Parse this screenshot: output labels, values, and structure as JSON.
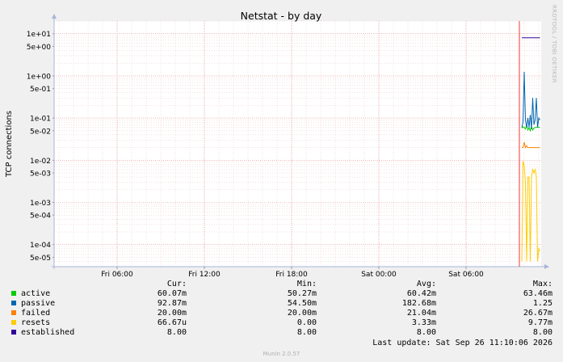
{
  "chart_data": {
    "type": "line",
    "title": "Netstat - by day",
    "ylabel": "TCP connections",
    "yscale": "log",
    "ylim": [
      3e-05,
      20
    ],
    "yticks": [
      {
        "value": 10,
        "label": "1e+01"
      },
      {
        "value": 5,
        "label": "5e+00"
      },
      {
        "value": 1,
        "label": "1e+00"
      },
      {
        "value": 0.5,
        "label": "5e-01"
      },
      {
        "value": 0.1,
        "label": "1e-01"
      },
      {
        "value": 0.05,
        "label": "5e-02"
      },
      {
        "value": 0.01,
        "label": "1e-02"
      },
      {
        "value": 0.005,
        "label": "5e-03"
      },
      {
        "value": 0.001,
        "label": "1e-03"
      },
      {
        "value": 0.0005,
        "label": "5e-04"
      },
      {
        "value": 0.0001,
        "label": "1e-04"
      },
      {
        "value": 5e-05,
        "label": "5e-05"
      }
    ],
    "xlim": [
      "Fri 01:40",
      "Sat 11:10"
    ],
    "xticks": [
      {
        "value": "Fri 06:00",
        "label": "Fri 06:00"
      },
      {
        "value": "Fri 12:00",
        "label": "Fri 12:00"
      },
      {
        "value": "Fri 18:00",
        "label": "Fri 18:00"
      },
      {
        "value": "Sat 00:00",
        "label": "Sat 00:00"
      },
      {
        "value": "Sat 06:00",
        "label": "Sat 06:00"
      }
    ],
    "grid": true,
    "series": [
      {
        "name": "active",
        "color": "#00cc00",
        "points": [
          [
            "Sat 09:50",
            0.058
          ],
          [
            "Sat 09:55",
            0.062
          ],
          [
            "Sat 10:00",
            0.06
          ],
          [
            "Sat 10:05",
            0.055
          ],
          [
            "Sat 10:10",
            0.07
          ],
          [
            "Sat 10:15",
            0.052
          ],
          [
            "Sat 10:20",
            0.06
          ],
          [
            "Sat 10:25",
            0.05
          ],
          [
            "Sat 10:30",
            0.063
          ],
          [
            "Sat 10:35",
            0.052
          ],
          [
            "Sat 10:40",
            0.058
          ],
          [
            "Sat 10:45",
            0.06
          ],
          [
            "Sat 10:50",
            0.06
          ],
          [
            "Sat 10:55",
            0.062
          ],
          [
            "Sat 11:00",
            0.06
          ],
          [
            "Sat 11:05",
            0.06
          ]
        ]
      },
      {
        "name": "passive",
        "color": "#0066b3",
        "points": [
          [
            "Sat 09:50",
            0.06
          ],
          [
            "Sat 09:55",
            0.08
          ],
          [
            "Sat 10:00",
            1.25
          ],
          [
            "Sat 10:05",
            0.09
          ],
          [
            "Sat 10:10",
            0.06
          ],
          [
            "Sat 10:15",
            0.1
          ],
          [
            "Sat 10:20",
            0.06
          ],
          [
            "Sat 10:25",
            0.12
          ],
          [
            "Sat 10:30",
            0.055
          ],
          [
            "Sat 10:35",
            0.3
          ],
          [
            "Sat 10:40",
            0.07
          ],
          [
            "Sat 10:45",
            0.09
          ],
          [
            "Sat 10:50",
            0.3
          ],
          [
            "Sat 10:55",
            0.06
          ],
          [
            "Sat 11:00",
            0.1
          ],
          [
            "Sat 11:05",
            0.09
          ]
        ]
      },
      {
        "name": "failed",
        "color": "#ff8000",
        "points": [
          [
            "Sat 09:50",
            0.02
          ],
          [
            "Sat 09:55",
            0.02
          ],
          [
            "Sat 10:00",
            0.0267
          ],
          [
            "Sat 10:05",
            0.02
          ],
          [
            "Sat 10:10",
            0.022
          ],
          [
            "Sat 10:15",
            0.02
          ],
          [
            "Sat 10:20",
            0.02
          ],
          [
            "Sat 10:25",
            0.02
          ],
          [
            "Sat 10:30",
            0.02
          ],
          [
            "Sat 10:35",
            0.02
          ],
          [
            "Sat 10:40",
            0.02
          ],
          [
            "Sat 10:45",
            0.02
          ],
          [
            "Sat 10:50",
            0.02
          ],
          [
            "Sat 10:55",
            0.02
          ],
          [
            "Sat 11:00",
            0.02
          ],
          [
            "Sat 11:05",
            0.02
          ]
        ]
      },
      {
        "name": "resets",
        "color": "#ffcc00",
        "points": [
          [
            "Sat 09:50",
            4e-05
          ],
          [
            "Sat 09:55",
            0.0095
          ],
          [
            "Sat 10:00",
            0.0075
          ],
          [
            "Sat 10:05",
            0.003
          ],
          [
            "Sat 10:10",
            4e-05
          ],
          [
            "Sat 10:15",
            0.004
          ],
          [
            "Sat 10:20",
            0.004
          ],
          [
            "Sat 10:25",
            4e-05
          ],
          [
            "Sat 10:30",
            0.004
          ],
          [
            "Sat 10:35",
            0.006
          ],
          [
            "Sat 10:40",
            0.005
          ],
          [
            "Sat 10:45",
            0.006
          ],
          [
            "Sat 10:50",
            0.004
          ],
          [
            "Sat 10:55",
            4e-05
          ],
          [
            "Sat 11:00",
            8e-05
          ],
          [
            "Sat 11:05",
            7e-05
          ]
        ]
      },
      {
        "name": "established",
        "color": "#330099",
        "points": [
          [
            "Sat 09:50",
            8
          ],
          [
            "Sat 11:05",
            8
          ]
        ]
      }
    ]
  },
  "legend": {
    "headers": {
      "cur": "Cur:",
      "min": "Min:",
      "avg": "Avg:",
      "max": "Max:"
    },
    "rows": [
      {
        "name": "active",
        "color": "#00cc00",
        "cur": "60.07m",
        "min": "50.27m",
        "avg": "60.42m",
        "max": "63.46m"
      },
      {
        "name": "passive",
        "color": "#0066b3",
        "cur": "92.87m",
        "min": "54.50m",
        "avg": "182.68m",
        "max": "1.25"
      },
      {
        "name": "failed",
        "color": "#ff8000",
        "cur": "20.00m",
        "min": "20.00m",
        "avg": "21.04m",
        "max": "26.67m"
      },
      {
        "name": "resets",
        "color": "#ffcc00",
        "cur": "66.67u",
        "min": "0.00",
        "avg": "3.33m",
        "max": "9.77m"
      },
      {
        "name": "established",
        "color": "#330099",
        "cur": "8.00",
        "min": "8.00",
        "avg": "8.00",
        "max": "8.00"
      }
    ]
  },
  "footer": {
    "last_update": "Last update: Sat Sep 26 11:10:06 2026",
    "version": "Munin 2.0.57",
    "watermark": "RRDTOOL / TOBI OETIKER"
  }
}
